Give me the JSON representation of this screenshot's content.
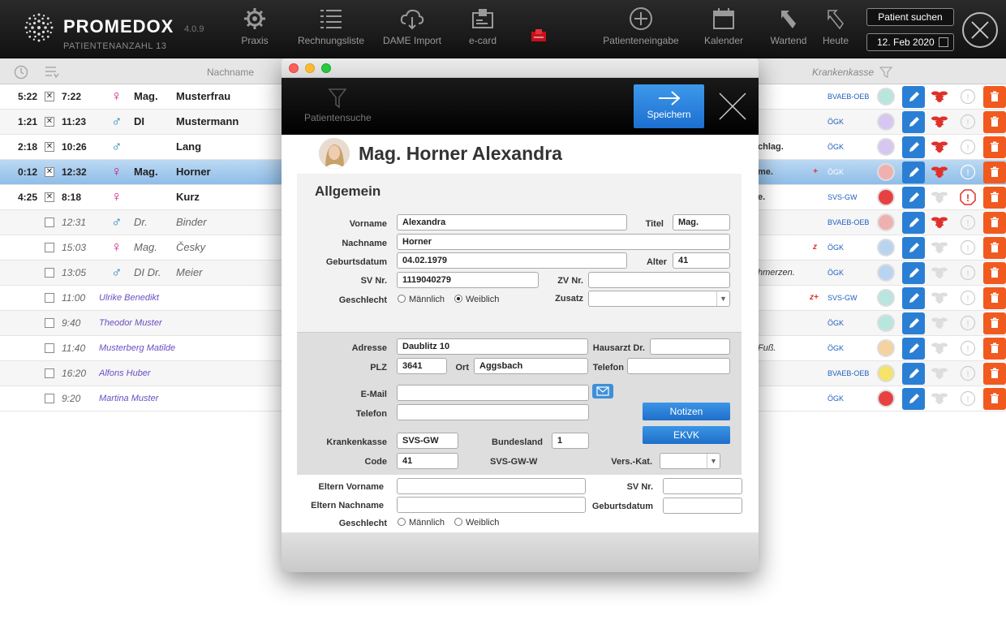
{
  "app": {
    "brand": "PROMEDOX",
    "version": "4.0.9",
    "patient_count": "PATIENTENANZAHL 13"
  },
  "toolbar": [
    {
      "label": "Praxis",
      "icon": "gear-icon"
    },
    {
      "label": "Rechnungsliste",
      "icon": "list-icon"
    },
    {
      "label": "DAME Import",
      "icon": "cloud-download-icon"
    },
    {
      "label": "e-card",
      "icon": "card-reader-icon"
    },
    {
      "label": "",
      "icon": "red-card-icon"
    },
    {
      "label": "Patienteneingabe",
      "icon": "plus-circle-icon"
    },
    {
      "label": "Kalender",
      "icon": "calendar-icon"
    },
    {
      "label": "Wartend",
      "icon": "arrow-back-icon"
    },
    {
      "label": "Heute",
      "icon": "arrow-back-outline-icon"
    }
  ],
  "search_button": "Patient suchen",
  "date": "12. Feb 2020",
  "columns": {
    "nachname": "Nachname",
    "krankenkasse": "Krankenkasse"
  },
  "rows": [
    {
      "t1": "5:22",
      "checked": "✕",
      "t2": "7:22",
      "gender": "f",
      "title": "Mag.",
      "name": "Musterfrau",
      "style": "bold",
      "kk": "BVAEB-OEB",
      "circle": "#b8e6df",
      "bee": true,
      "warn": false,
      "note": "",
      "mark": ""
    },
    {
      "t1": "1:21",
      "checked": "✕",
      "t2": "11:23",
      "gender": "m",
      "title": "DI",
      "name": "Mustermann",
      "style": "bold",
      "kk": "ÖGK",
      "circle": "#d5c6f2",
      "bee": true,
      "warn": false,
      "note": "",
      "mark": ""
    },
    {
      "t1": "2:18",
      "checked": "✕",
      "t2": "10:26",
      "gender": "m",
      "title": "",
      "name": "Lang",
      "style": "bold",
      "kk": "ÖGK",
      "circle": "#d5c6f2",
      "bee": true,
      "warn": false,
      "note": "chlag.",
      "mark": ""
    },
    {
      "t1": "0:12",
      "checked": "✕",
      "t2": "12:32",
      "gender": "f",
      "title": "Mag.",
      "name": "Horner",
      "style": "bold",
      "kk": "ÖGK",
      "circle": "#f0b0b0",
      "bee": true,
      "warn": true,
      "note": "me.",
      "mark": "+"
    },
    {
      "t1": "4:25",
      "checked": "✕",
      "t2": "8:18",
      "gender": "f",
      "title": "",
      "name": "Kurz",
      "style": "bold",
      "kk": "SVS-GW",
      "circle": "#e84040",
      "bee": false,
      "warn": true,
      "note": "e.",
      "mark": ""
    },
    {
      "t1": "",
      "checked": "",
      "t2": "12:31",
      "gender": "m",
      "title": "Dr.",
      "name": "Binder",
      "style": "italic",
      "kk": "BVAEB-OEB",
      "circle": "#f0b0b0",
      "bee": true,
      "warn": false,
      "note": "",
      "mark": ""
    },
    {
      "t1": "",
      "checked": "",
      "t2": "15:03",
      "gender": "f",
      "title": "Mag.",
      "name": "Česky",
      "style": "italic",
      "kk": "ÖGK",
      "circle": "#b9d4f0",
      "bee": false,
      "warn": false,
      "note": "",
      "mark": "z"
    },
    {
      "t1": "",
      "checked": "",
      "t2": "13:05",
      "gender": "m",
      "title": "DI Dr.",
      "name": "Meier",
      "style": "italic",
      "kk": "ÖGK",
      "circle": "#b9d4f0",
      "bee": false,
      "warn": false,
      "note": "hmerzen.",
      "mark": ""
    },
    {
      "t1": "",
      "checked": "",
      "t2": "11:00",
      "gender": "",
      "title": "",
      "name": "Ulrike Benedikt",
      "style": "link",
      "kk": "SVS-GW",
      "circle": "#b8e6df",
      "bee": false,
      "warn": false,
      "note": "",
      "mark": "z+"
    },
    {
      "t1": "",
      "checked": "",
      "t2": "9:40",
      "gender": "",
      "title": "",
      "name": "Theodor Muster",
      "style": "link",
      "kk": "ÖGK",
      "circle": "#b8e6df",
      "bee": false,
      "warn": false,
      "note": "",
      "mark": ""
    },
    {
      "t1": "",
      "checked": "",
      "t2": "11:40",
      "gender": "",
      "title": "",
      "name": "Musterberg Matilde",
      "style": "link",
      "kk": "ÖGK",
      "circle": "#f5d3a0",
      "bee": false,
      "warn": false,
      "note": "Fuß.",
      "mark": ""
    },
    {
      "t1": "",
      "checked": "",
      "t2": "16:20",
      "gender": "",
      "title": "",
      "name": "Alfons Huber",
      "style": "link",
      "kk": "BVAEB-OEB",
      "circle": "#f5e36a",
      "bee": false,
      "warn": false,
      "note": "",
      "mark": ""
    },
    {
      "t1": "",
      "checked": "",
      "t2": "9:20",
      "gender": "",
      "title": "",
      "name": "Martina Muster",
      "style": "link",
      "kk": "ÖGK",
      "circle": "#e84040",
      "bee": false,
      "warn": false,
      "note": "",
      "mark": ""
    }
  ],
  "modal": {
    "search_label": "Patientensuche",
    "save_label": "Speichern",
    "patient_name": "Mag. Horner Alexandra",
    "section_title": "Allgemein",
    "labels": {
      "vorname": "Vorname",
      "titel": "Titel",
      "nachname": "Nachname",
      "geburtsdatum": "Geburtsdatum",
      "alter": "Alter",
      "svnr": "SV Nr.",
      "zvnr": "ZV Nr.",
      "geschlecht": "Geschlecht",
      "zusatz": "Zusatz",
      "maennlich": "Männlich",
      "weiblich": "Weiblich",
      "adresse": "Adresse",
      "hausarzt": "Hausarzt Dr.",
      "plz": "PLZ",
      "ort": "Ort",
      "telefon": "Telefon",
      "email": "E-Mail",
      "krankenkasse": "Krankenkasse",
      "bundesland": "Bundesland",
      "code": "Code",
      "verskat": "Vers.-Kat.",
      "eltern_vorname": "Eltern Vorname",
      "eltern_svnr": "SV Nr.",
      "eltern_nachname": "Eltern Nachname",
      "eltern_geburtsdatum": "Geburtsdatum",
      "eltern_geschlecht": "Geschlecht"
    },
    "values": {
      "vorname": "Alexandra",
      "titel": "Mag.",
      "nachname": "Horner",
      "geburtsdatum": "04.02.1979",
      "alter": "41",
      "svnr": "1119040279",
      "zvnr": "",
      "zusatz": "",
      "adresse": "Daublitz 10",
      "hausarzt": "",
      "plz": "3641",
      "ort": "Aggsbach",
      "telefon": "",
      "email": "",
      "telefon2": "",
      "krankenkasse": "SVS-GW",
      "bundesland": "1",
      "code": "41",
      "kasse_name": "SVS-GW-W",
      "verskat": "",
      "eltern_vorname": "",
      "eltern_svnr": "",
      "eltern_nachname": "",
      "eltern_geburtsdatum": ""
    },
    "buttons": {
      "notizen": "Notizen",
      "ekvk": "EKVK"
    }
  }
}
